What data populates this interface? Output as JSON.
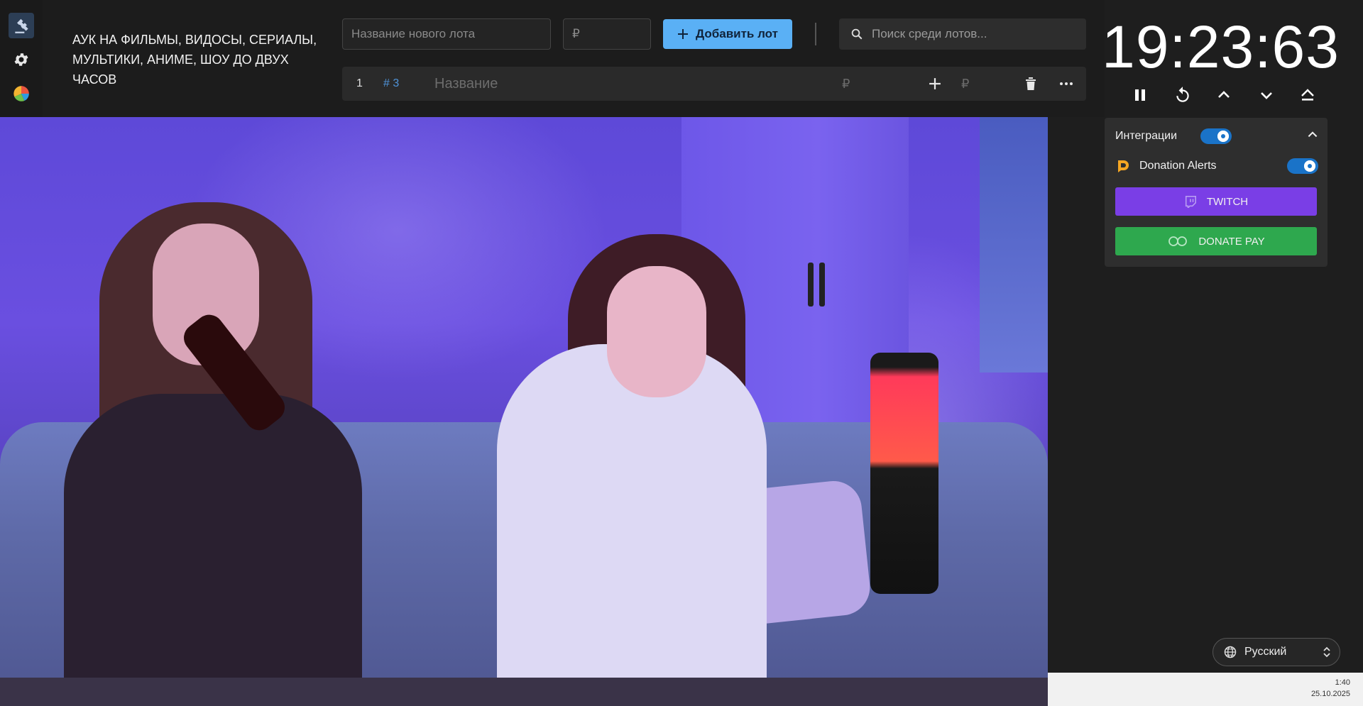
{
  "header": {
    "auction_title": "АУК НА ФИЛЬМЫ, ВИДОСЫ, СЕРИАЛЫ, МУЛЬТИКИ, АНИМЕ, ШОУ ДО ДВУХ ЧАСОВ",
    "lot_name_placeholder": "Название нового лота",
    "lot_price_placeholder": "₽",
    "add_lot_label": "Добавить лот",
    "search_placeholder": "Поиск среди лотов..."
  },
  "left_rail": {
    "items": [
      {
        "icon": "gavel-icon",
        "active": true
      },
      {
        "icon": "gear-icon",
        "active": false
      },
      {
        "icon": "pie-chart-icon",
        "active": false
      }
    ]
  },
  "lot_row": {
    "index": "1",
    "id": "# 3",
    "name_placeholder": "Название",
    "amount_currency": "₽",
    "add_currency": "₽"
  },
  "timer": {
    "display": "19:23:63"
  },
  "integrations": {
    "label": "Интеграции",
    "enabled": true,
    "donation_alerts_label": "Donation Alerts",
    "donation_alerts_enabled": true,
    "twitch_label": "TWITCH",
    "donatepay_label": "DONATE PAY",
    "colors": {
      "twitch": "#7a3ee6",
      "donatepay": "#2ea84e",
      "toggle": "#1a73c8"
    }
  },
  "language": {
    "selected": "Русский"
  },
  "tray": {
    "time": "1:40",
    "date": "25.10.2025"
  }
}
